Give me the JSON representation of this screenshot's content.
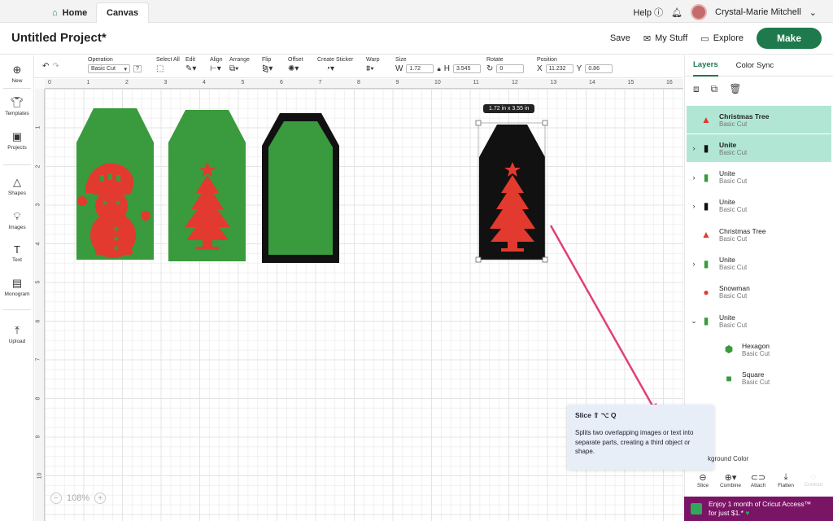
{
  "tabs": {
    "home": "Home",
    "canvas": "Canvas"
  },
  "top": {
    "help": "Help",
    "user": "Crystal-Marie Mitchell"
  },
  "header": {
    "title": "Untitled Project*",
    "save": "Save",
    "my_stuff": "My Stuff",
    "explore": "Explore",
    "make": "Make"
  },
  "toolbar": {
    "operation_label": "Operation",
    "operation_value": "Basic Cut",
    "select_all": "Select All",
    "edit": "Edit",
    "align": "Align",
    "arrange": "Arrange",
    "flip": "Flip",
    "offset": "Offset",
    "create_sticker": "Create Sticker",
    "warp": "Warp",
    "size": "Size",
    "w_label": "W",
    "w_value": "1.72",
    "h_label": "H",
    "h_value": "3.545",
    "rotate": "Rotate",
    "rotate_value": "0",
    "position": "Position",
    "x_label": "X",
    "x_value": "11.232",
    "y_label": "Y",
    "y_value": "0.86"
  },
  "left_nav": {
    "new": "New",
    "templates": "Templates",
    "projects": "Projects",
    "shapes": "Shapes",
    "images": "Images",
    "text": "Text",
    "monogram": "Monogram",
    "upload": "Upload"
  },
  "ruler": {
    "top": [
      "0",
      "1",
      "2",
      "3",
      "4",
      "5",
      "6",
      "7",
      "8",
      "9",
      "10",
      "11",
      "12",
      "13",
      "14",
      "15",
      "16"
    ],
    "left": [
      "1",
      "2",
      "3",
      "4",
      "5",
      "6",
      "7",
      "8",
      "9",
      "10"
    ]
  },
  "canvas": {
    "size_tag": "1.72  in x 3.55  in",
    "zoom": "108%"
  },
  "panel": {
    "tab_layers": "Layers",
    "tab_color_sync": "Color Sync",
    "layers": [
      {
        "name": "Christmas Tree",
        "op": "Basic Cut"
      },
      {
        "name": "Unite",
        "op": "Basic Cut"
      },
      {
        "name": "Unite",
        "op": "Basic Cut"
      },
      {
        "name": "Unite",
        "op": "Basic Cut"
      },
      {
        "name": "Christmas Tree",
        "op": "Basic Cut"
      },
      {
        "name": "Unite",
        "op": "Basic Cut"
      },
      {
        "name": "Snowman",
        "op": "Basic Cut"
      },
      {
        "name": "Unite",
        "op": "Basic Cut"
      },
      {
        "name": "Hexagon",
        "op": "Basic Cut"
      },
      {
        "name": "Square",
        "op": "Basic Cut"
      }
    ],
    "bg_color": "kground Color"
  },
  "tooltip": {
    "title": "Slice ⇧ ⌥ Q",
    "body": "Splits two overlapping images or text into separate parts, creating a third object or shape."
  },
  "bottom_tools": {
    "slice": "Slice",
    "combine": "Combine",
    "attach": "Attach",
    "flatten": "Flatten",
    "contour": "Contour"
  },
  "promo": {
    "line1": "Enjoy 1 month of Cricut Access™",
    "line2": "for just $1.*"
  },
  "colors": {
    "green": "#3a9a3e",
    "red": "#e23a2e",
    "black": "#111111",
    "brand": "#1e7a4c",
    "arrow": "#e0407a"
  }
}
